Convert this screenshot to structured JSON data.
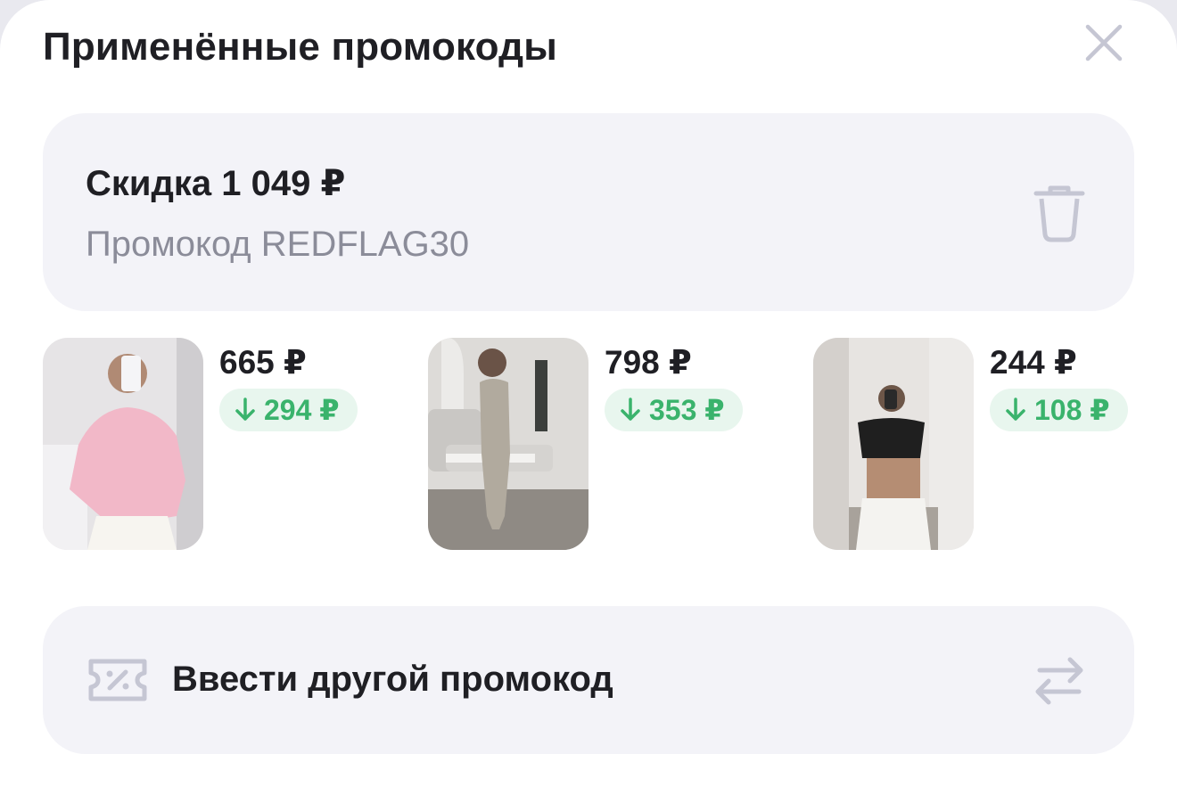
{
  "header": {
    "title": "Применённые промокоды",
    "close_icon": "close-icon"
  },
  "promo": {
    "discount_label": "Скидка 1 049 ₽",
    "code_label": "Промокод REDFLAG30",
    "delete_icon": "trash-icon"
  },
  "products": [
    {
      "price": "665 ₽",
      "discount": "294 ₽",
      "image": "woman in pink long-sleeve top and white skirt"
    },
    {
      "price": "798 ₽",
      "discount": "353 ₽",
      "image": "woman in beige knit maxi dress in living room"
    },
    {
      "price": "244 ₽",
      "discount": "108 ₽",
      "image": "woman in black crop top and white cargo pants in hallway"
    }
  ],
  "enter_other": {
    "label": "Ввести другой промокод",
    "icon": "coupon-icon",
    "action_icon": "swap-icon"
  },
  "colors": {
    "accent_green": "#3ab36c",
    "card_bg": "#f3f3f8",
    "muted_text": "#8b8c99",
    "icon_gray": "#c5c6d3"
  }
}
